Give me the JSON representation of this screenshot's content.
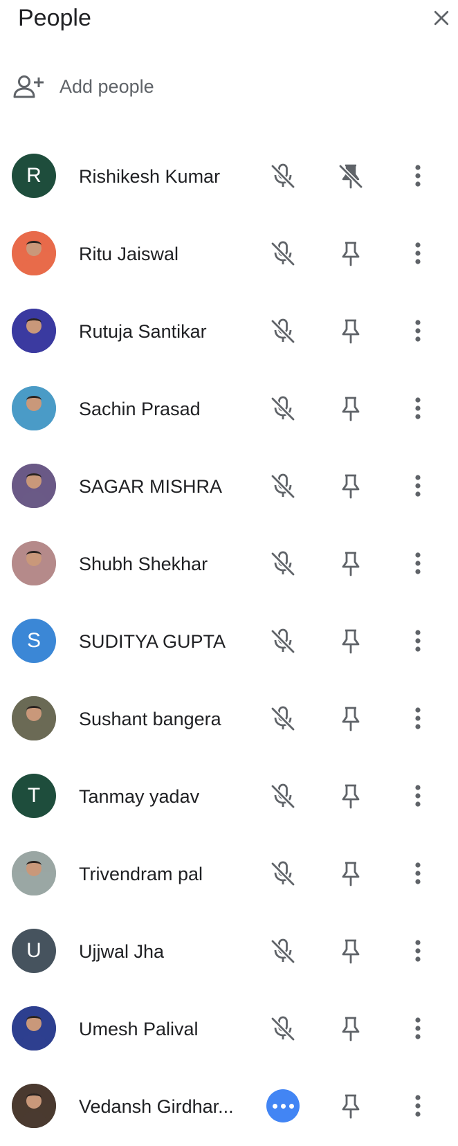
{
  "panel": {
    "title": "People",
    "close_icon": "close-icon"
  },
  "add_people": {
    "label": "Add people",
    "icon": "person-add-icon"
  },
  "participants": [
    {
      "name": "Rishikesh Kumar",
      "avatar_type": "initial",
      "initial": "R",
      "avatar_color": "#1e4d3c",
      "mic": "muted",
      "pin": "pinned"
    },
    {
      "name": "Ritu Jaiswal",
      "avatar_type": "photo",
      "avatar_color": "#e86b4a",
      "mic": "muted",
      "pin": "unpinned"
    },
    {
      "name": "Rutuja Santikar",
      "avatar_type": "photo",
      "avatar_color": "#3b3aa0",
      "mic": "muted",
      "pin": "unpinned"
    },
    {
      "name": "Sachin Prasad",
      "avatar_type": "photo",
      "avatar_color": "#4a9bc7",
      "mic": "muted",
      "pin": "unpinned"
    },
    {
      "name": "SAGAR MISHRA",
      "avatar_type": "photo",
      "avatar_color": "#6a5a86",
      "mic": "muted",
      "pin": "unpinned"
    },
    {
      "name": "Shubh Shekhar",
      "avatar_type": "photo",
      "avatar_color": "#b58a8a",
      "mic": "muted",
      "pin": "unpinned"
    },
    {
      "name": "SUDITYA GUPTA",
      "avatar_type": "initial",
      "initial": "S",
      "avatar_color": "#3b87d6",
      "mic": "muted",
      "pin": "unpinned"
    },
    {
      "name": "Sushant bangera",
      "avatar_type": "photo",
      "avatar_color": "#6b6a55",
      "mic": "muted",
      "pin": "unpinned"
    },
    {
      "name": "Tanmay yadav",
      "avatar_type": "initial",
      "initial": "T",
      "avatar_color": "#1e4d3c",
      "mic": "muted",
      "pin": "unpinned"
    },
    {
      "name": "Trivendram pal",
      "avatar_type": "photo",
      "avatar_color": "#9aa7a4",
      "mic": "muted",
      "pin": "unpinned"
    },
    {
      "name": "Ujjwal Jha",
      "avatar_type": "initial",
      "initial": "U",
      "avatar_color": "#46535e",
      "mic": "muted",
      "pin": "unpinned"
    },
    {
      "name": "Umesh Palival",
      "avatar_type": "photo",
      "avatar_color": "#2e3f8f",
      "mic": "muted",
      "pin": "unpinned"
    },
    {
      "name": "Vedansh Girdhar...",
      "avatar_type": "photo",
      "avatar_color": "#4a3a30",
      "mic": "speaking",
      "pin": "unpinned"
    }
  ],
  "colors": {
    "icon_gray": "#5f6368",
    "speaking_blue": "#4285f4"
  }
}
